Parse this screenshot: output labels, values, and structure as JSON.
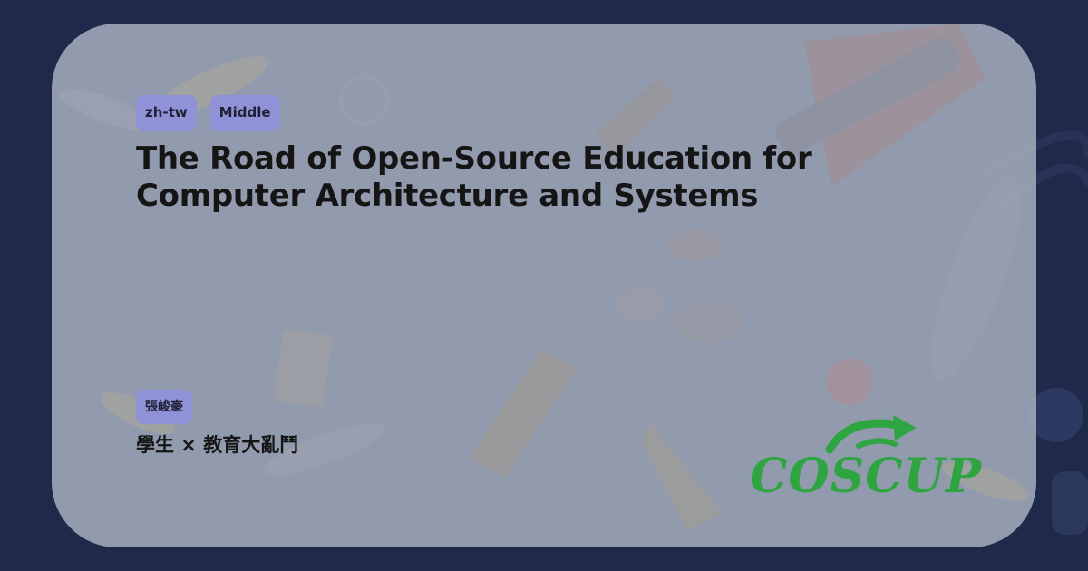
{
  "session": {
    "tags": [
      "zh-tw",
      "Middle"
    ],
    "title": "The Road of Open-Source Education for Computer Architecture and Systems",
    "speaker": "張峻豪",
    "track": "學生 × 教育大亂鬥"
  },
  "brand": {
    "logo_text": "COSCUP",
    "logo_color": "#2fa542",
    "arrow_icon": "circular-arrow-icon"
  },
  "colors": {
    "background": "#1f2a4a",
    "card": "#afb7c6",
    "tag": "#8f92d6",
    "text": "#151515"
  }
}
